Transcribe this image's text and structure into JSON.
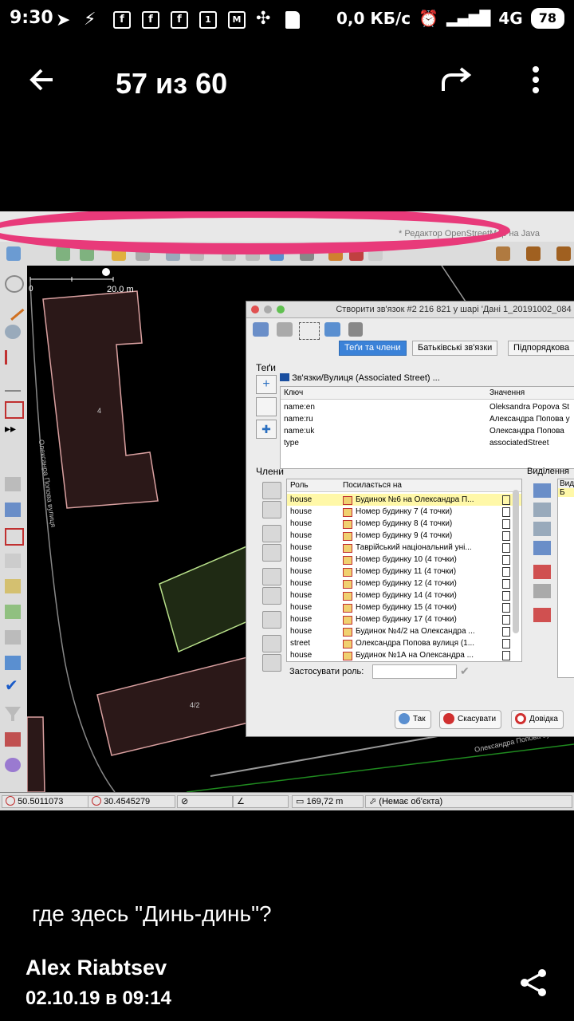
{
  "status_bar": {
    "time": "9:30",
    "network_speed": "0,0 КБ/с",
    "network_type": "4G",
    "battery": "78",
    "icons": [
      "telegram-icon",
      "flash-icon",
      "facebook-icon",
      "facebook-icon",
      "facebook-icon",
      "calendar-icon",
      "gmail-icon",
      "pinwheel-icon",
      "sd-card-icon"
    ]
  },
  "top_bar": {
    "counter": "57 из 60"
  },
  "josm": {
    "window_title": "* Редактор OpenStreetMap на Java",
    "map_scale": "20.0 m",
    "map_zero": "0",
    "street_label_left": "Олексанра Попова вулиця",
    "street_label_right": "Олександра Попова вулиця",
    "building_label_1": "4",
    "building_label_2": "4/2",
    "statusline": {
      "lat": "50.5011073",
      "lon": "30.4545279",
      "distance": "169,72 m",
      "object": "(Немає об'єкта)"
    },
    "dialog": {
      "title": "Створити зв'язок #2 216 821 у шарі 'Дані 1_20191002_084",
      "tabs": [
        "Теґи та члени",
        "Батьківські зв'язки",
        "Підпорядкова"
      ],
      "tags_label": "Теґи",
      "relation_caption": "Зв'язки/Вулиця (Associated Street) ...",
      "tags_columns": [
        "Ключ",
        "Значення"
      ],
      "tags": [
        {
          "key": "name:en",
          "value": "Oleksandra Popova St"
        },
        {
          "key": "name:ru",
          "value": "Александра Попова у"
        },
        {
          "key": "name:uk",
          "value": "Олександра Попова"
        },
        {
          "key": "type",
          "value": "associatedStreet"
        }
      ],
      "members_label": "Члени",
      "selection_label": "Виділення",
      "selection_col": "Виді",
      "selection_item": "Б",
      "members_columns": [
        "Роль",
        "Посилається на"
      ],
      "members": [
        {
          "role": "house",
          "ref": "Будинок №6 на Олександра П..."
        },
        {
          "role": "house",
          "ref": "Номер будинку 7 (4 точки)"
        },
        {
          "role": "house",
          "ref": "Номер будинку 8 (4 точки)"
        },
        {
          "role": "house",
          "ref": "Номер будинку 9 (4 точки)"
        },
        {
          "role": "house",
          "ref": "Таврійський національний уні..."
        },
        {
          "role": "house",
          "ref": "Номер будинку 10 (4 точки)"
        },
        {
          "role": "house",
          "ref": "Номер будинку 11 (4 точки)"
        },
        {
          "role": "house",
          "ref": "Номер будинку 12 (4 точки)"
        },
        {
          "role": "house",
          "ref": "Номер будинку 14 (4 точки)"
        },
        {
          "role": "house",
          "ref": "Номер будинку 15 (4 точки)"
        },
        {
          "role": "house",
          "ref": "Номер будинку 17 (4 точки)"
        },
        {
          "role": "house",
          "ref": "Будинок №4/2 на Олександра ..."
        },
        {
          "role": "street",
          "ref": "Олександра Попова вулиця (1..."
        },
        {
          "role": "house",
          "ref": "Будинок №1А на Олександра ..."
        }
      ],
      "apply_role_label": "Застосувати роль:",
      "buttons": {
        "ok": "Так",
        "cancel": "Скасувати",
        "help": "Довідка"
      }
    }
  },
  "post": {
    "caption": "где здесь \"Динь-динь\"?",
    "author": "Alex Riabtsev",
    "date": "02.10.19 в 09:14"
  }
}
